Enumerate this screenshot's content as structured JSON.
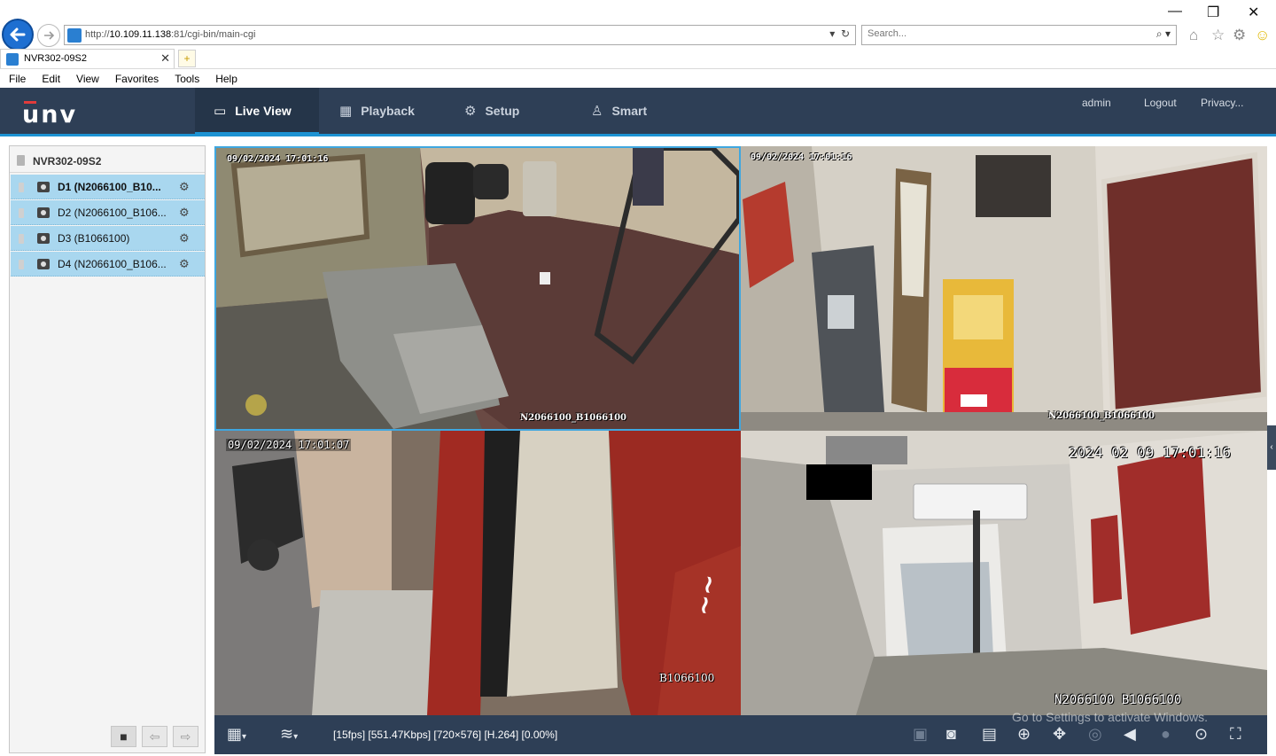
{
  "browser": {
    "url_prefix": "http://",
    "url_host": "10.109.11.138",
    "url_rest": ":81/cgi-bin/main-cgi",
    "search_placeholder": "Search...",
    "tab_title": "NVR302-09S2",
    "menu": [
      "File",
      "Edit",
      "View",
      "Favorites",
      "Tools",
      "Help"
    ]
  },
  "header": {
    "logo": "UNV",
    "tabs": [
      {
        "label": "Live View",
        "icon": "monitor-icon",
        "active": true
      },
      {
        "label": "Playback",
        "icon": "film-icon"
      },
      {
        "label": "Setup",
        "icon": "gear-icon"
      },
      {
        "label": "Smart",
        "icon": "person-search-icon"
      }
    ],
    "user": "admin",
    "logout": "Logout",
    "privacy": "Privacy..."
  },
  "sidebar": {
    "device": "NVR302-09S2",
    "channels": [
      {
        "label": "D1 (N2066100_B10...",
        "bold": true
      },
      {
        "label": "D2 (N2066100_B106...",
        "bold": false
      },
      {
        "label": "D3 (B1066100)",
        "bold": false
      },
      {
        "label": "D4 (N2066100_B106...",
        "bold": false
      }
    ]
  },
  "video": {
    "panes": [
      {
        "timestamp": "09/02/2024 17:01:16",
        "name": "N2066100_B1066100"
      },
      {
        "timestamp": "09/02/2024 17:01:16",
        "name": "N2066100_B1066100"
      },
      {
        "timestamp": "09/02/2024 17:01:07",
        "name": "B1066100"
      },
      {
        "timestamp": "2024 02 09 17:01:16",
        "name": "N2066100 B1066100"
      }
    ]
  },
  "toolbar": {
    "status": "[15fps] [551.47Kbps] [720×576] [H.264] [0.00%]",
    "watermark": "Go to Settings to activate Windows."
  }
}
